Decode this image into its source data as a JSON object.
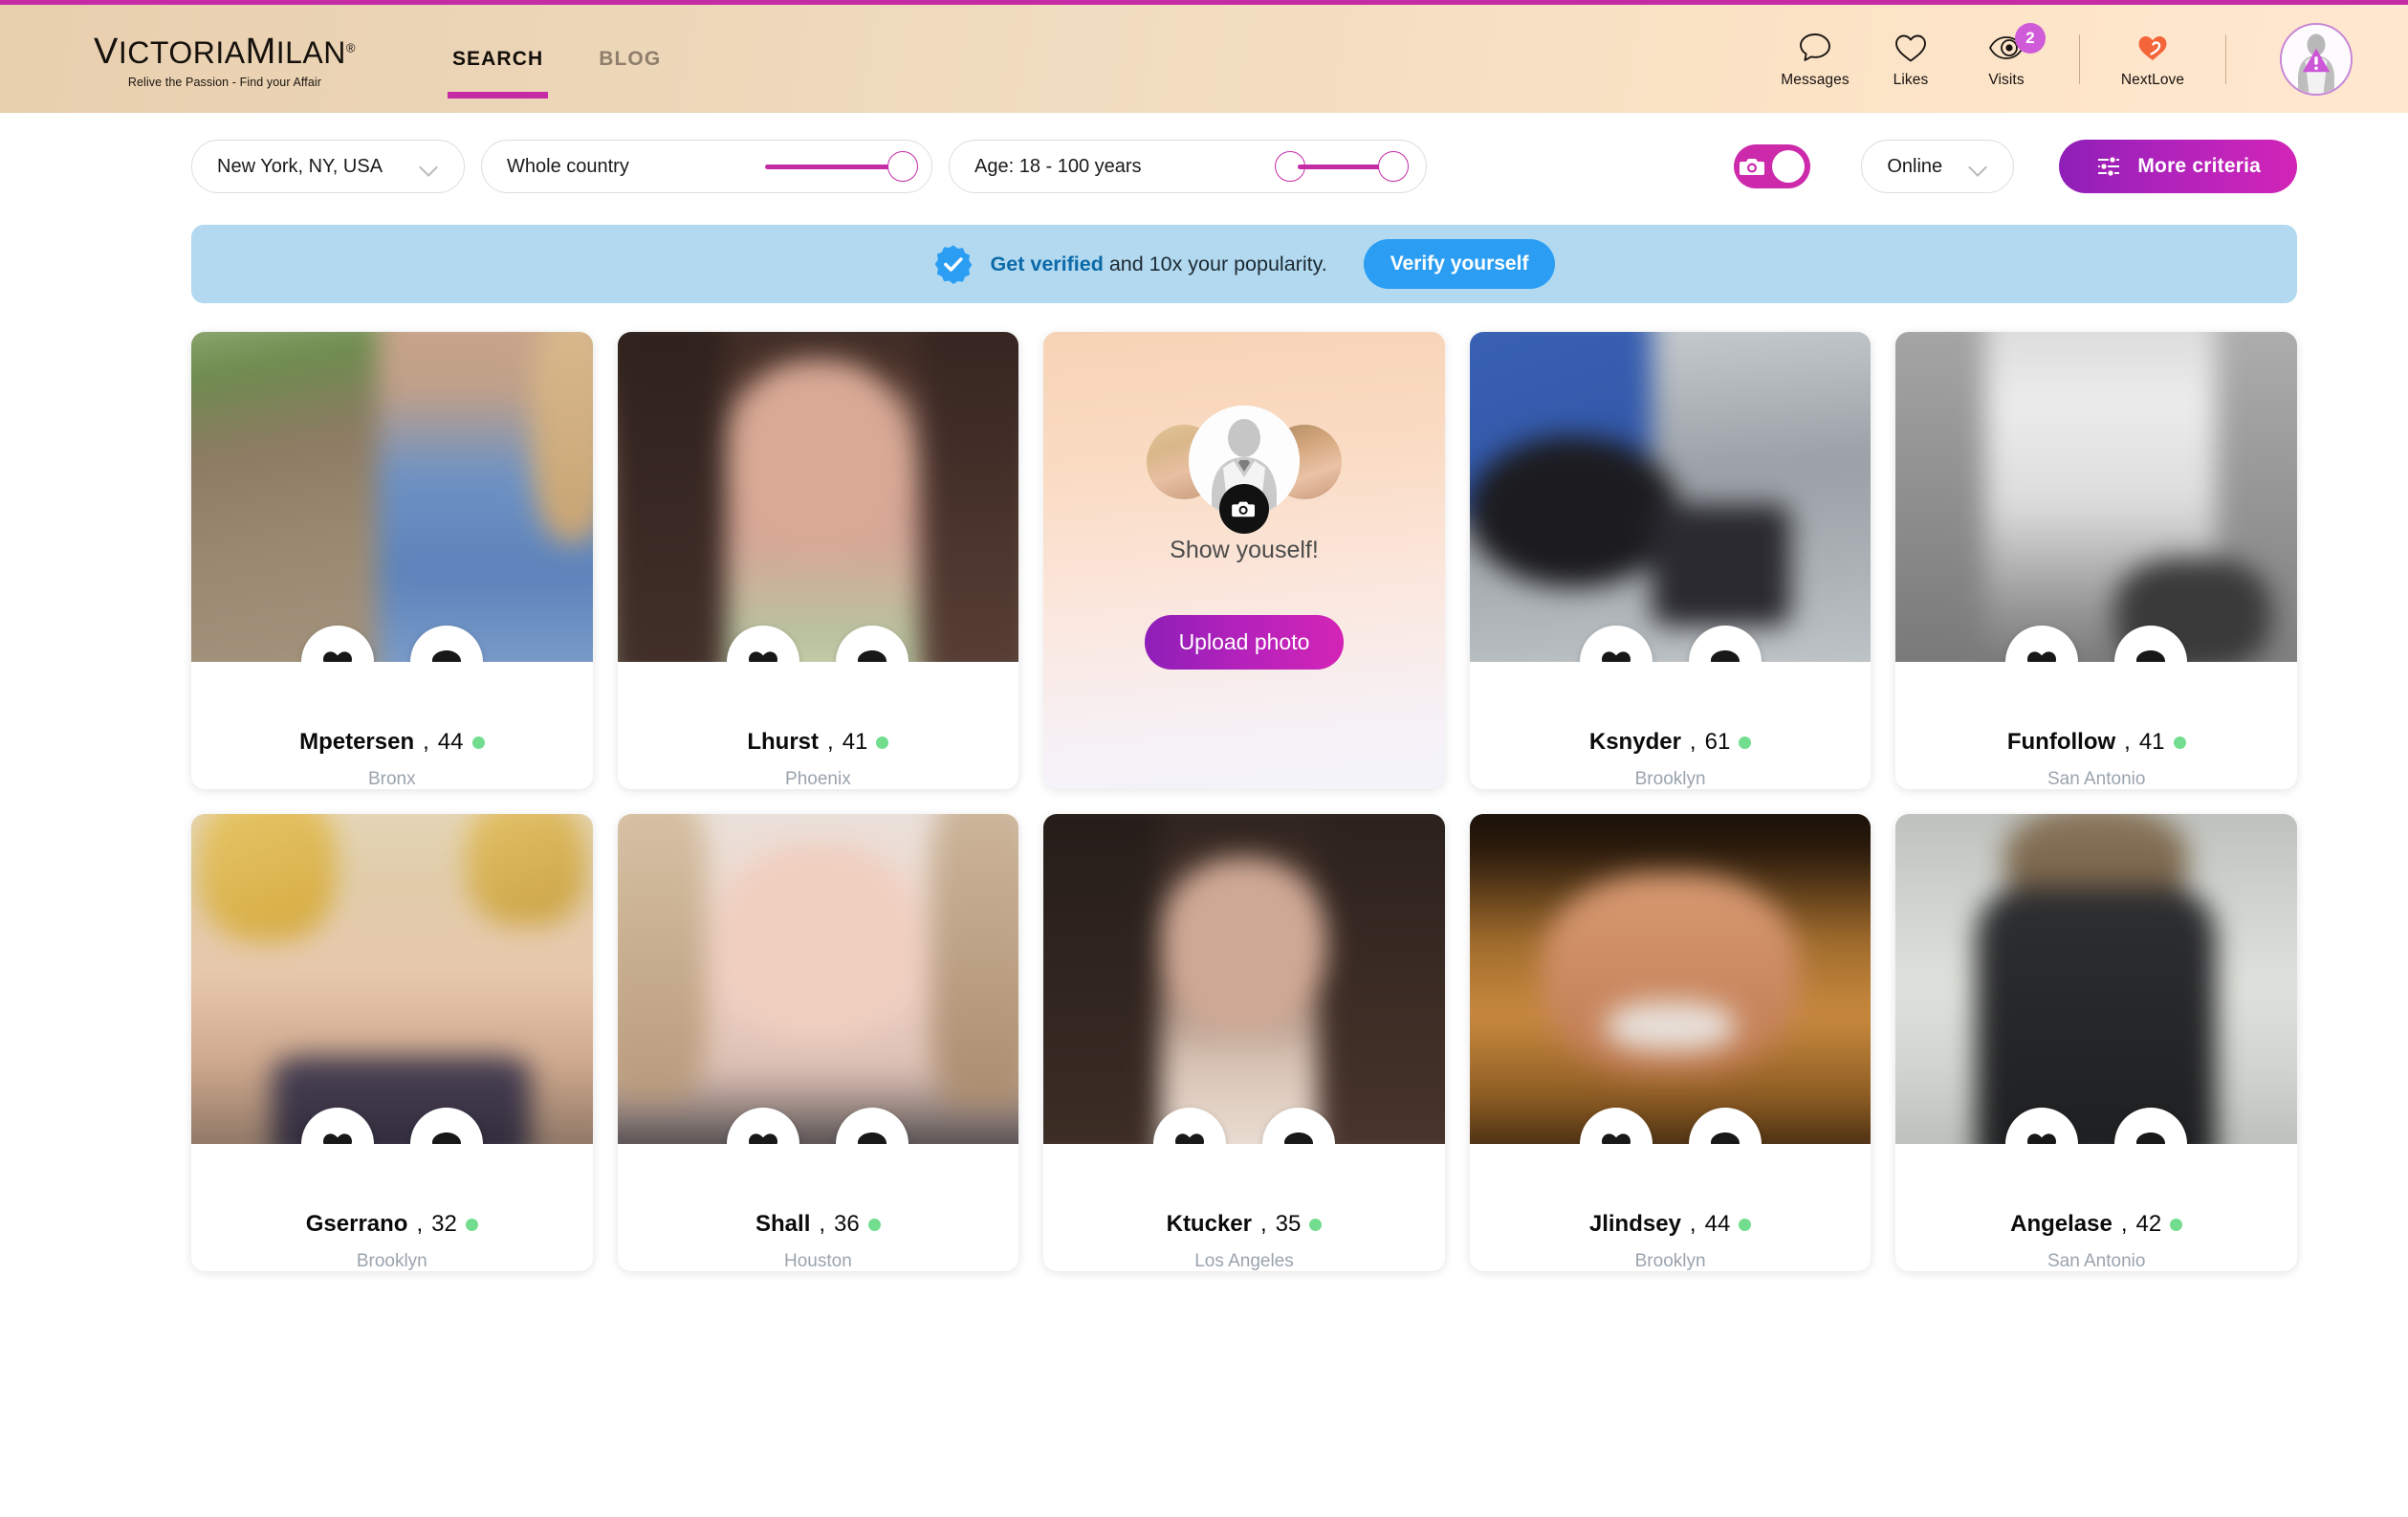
{
  "header": {
    "brand": {
      "name_part1": "V",
      "name_rest": "ICTORIA",
      "name_part2": "M",
      "name_rest2": "ILAN",
      "registered": "®",
      "tagline": "Relive the Passion - Find your Affair"
    },
    "nav": [
      {
        "label": "SEARCH",
        "active": true
      },
      {
        "label": "BLOG",
        "active": false
      }
    ],
    "icons": [
      {
        "name": "messages",
        "label": "Messages",
        "icon": "speech-bubble-icon",
        "badge": null
      },
      {
        "name": "likes",
        "label": "Likes",
        "icon": "heart-outline-icon",
        "badge": null
      },
      {
        "name": "visits",
        "label": "Visits",
        "icon": "eye-icon",
        "badge": "2"
      },
      {
        "name": "nextlove",
        "label": "NextLove",
        "icon": "nextlove-heart-icon",
        "badge": null
      }
    ],
    "avatar_alt": "profile-avatar-incomplete"
  },
  "filters": {
    "location": {
      "value": "New York, NY, USA"
    },
    "distance": {
      "label": "Whole country"
    },
    "age": {
      "label": "Age: 18 - 100 years",
      "min": 18,
      "max": 100
    },
    "photo_toggle": {
      "state": "on",
      "icon": "camera-icon"
    },
    "status": {
      "value": "Online"
    },
    "more": {
      "label": "More criteria",
      "icon": "sliders-icon"
    }
  },
  "banner": {
    "icon": "verified-badge-icon",
    "strong": "Get verified",
    "rest": " and 10x your popularity.",
    "button": "Verify yourself"
  },
  "upload_card": {
    "title": "Show youself!",
    "button": "Upload photo",
    "camera_icon": "camera-icon"
  },
  "card_actions": {
    "like": "heart-filled-icon",
    "message": "speech-bubble-filled-icon"
  },
  "profiles": [
    {
      "name": "Mpetersen",
      "age": "44",
      "city": "Bronx",
      "online": true,
      "photo": "outdoor-path-woman-blue-dress"
    },
    {
      "name": "Lhurst",
      "age": "41",
      "city": "Phoenix",
      "online": true,
      "photo": "dark-hair-woman-closeup"
    },
    {
      "name": "Ksnyder",
      "age": "61",
      "city": "Brooklyn",
      "online": true,
      "photo": "woman-blue-dress-by-car"
    },
    {
      "name": "Funfollow",
      "age": "41",
      "city": "San Antonio",
      "online": true,
      "photo": "greyscale-portrait"
    },
    {
      "name": "Gserrano",
      "age": "32",
      "city": "Brooklyn",
      "online": true,
      "photo": "blonde-woman-floral"
    },
    {
      "name": "Shall",
      "age": "36",
      "city": "Houston",
      "online": true,
      "photo": "blonde-woman-indoor"
    },
    {
      "name": "Ktucker",
      "age": "35",
      "city": "Los Angeles",
      "online": true,
      "photo": "long-dark-hair-woman"
    },
    {
      "name": "Jlindsey",
      "age": "44",
      "city": "Brooklyn",
      "online": true,
      "photo": "woman-fur-hood-smiling"
    },
    {
      "name": "Angelase",
      "age": "42",
      "city": "San Antonio",
      "online": true,
      "photo": "woman-winter-coat-snow"
    }
  ],
  "colors": {
    "accent_magenta": "#c42ba5",
    "header_gradient_start": "#e8cfae",
    "header_gradient_end": "#ffe8d0",
    "banner_blue": "#b2d9f0",
    "verify_button_blue": "#2b9ef3",
    "online_green": "#72dd8f",
    "badge_purple": "#cf5bd8"
  }
}
